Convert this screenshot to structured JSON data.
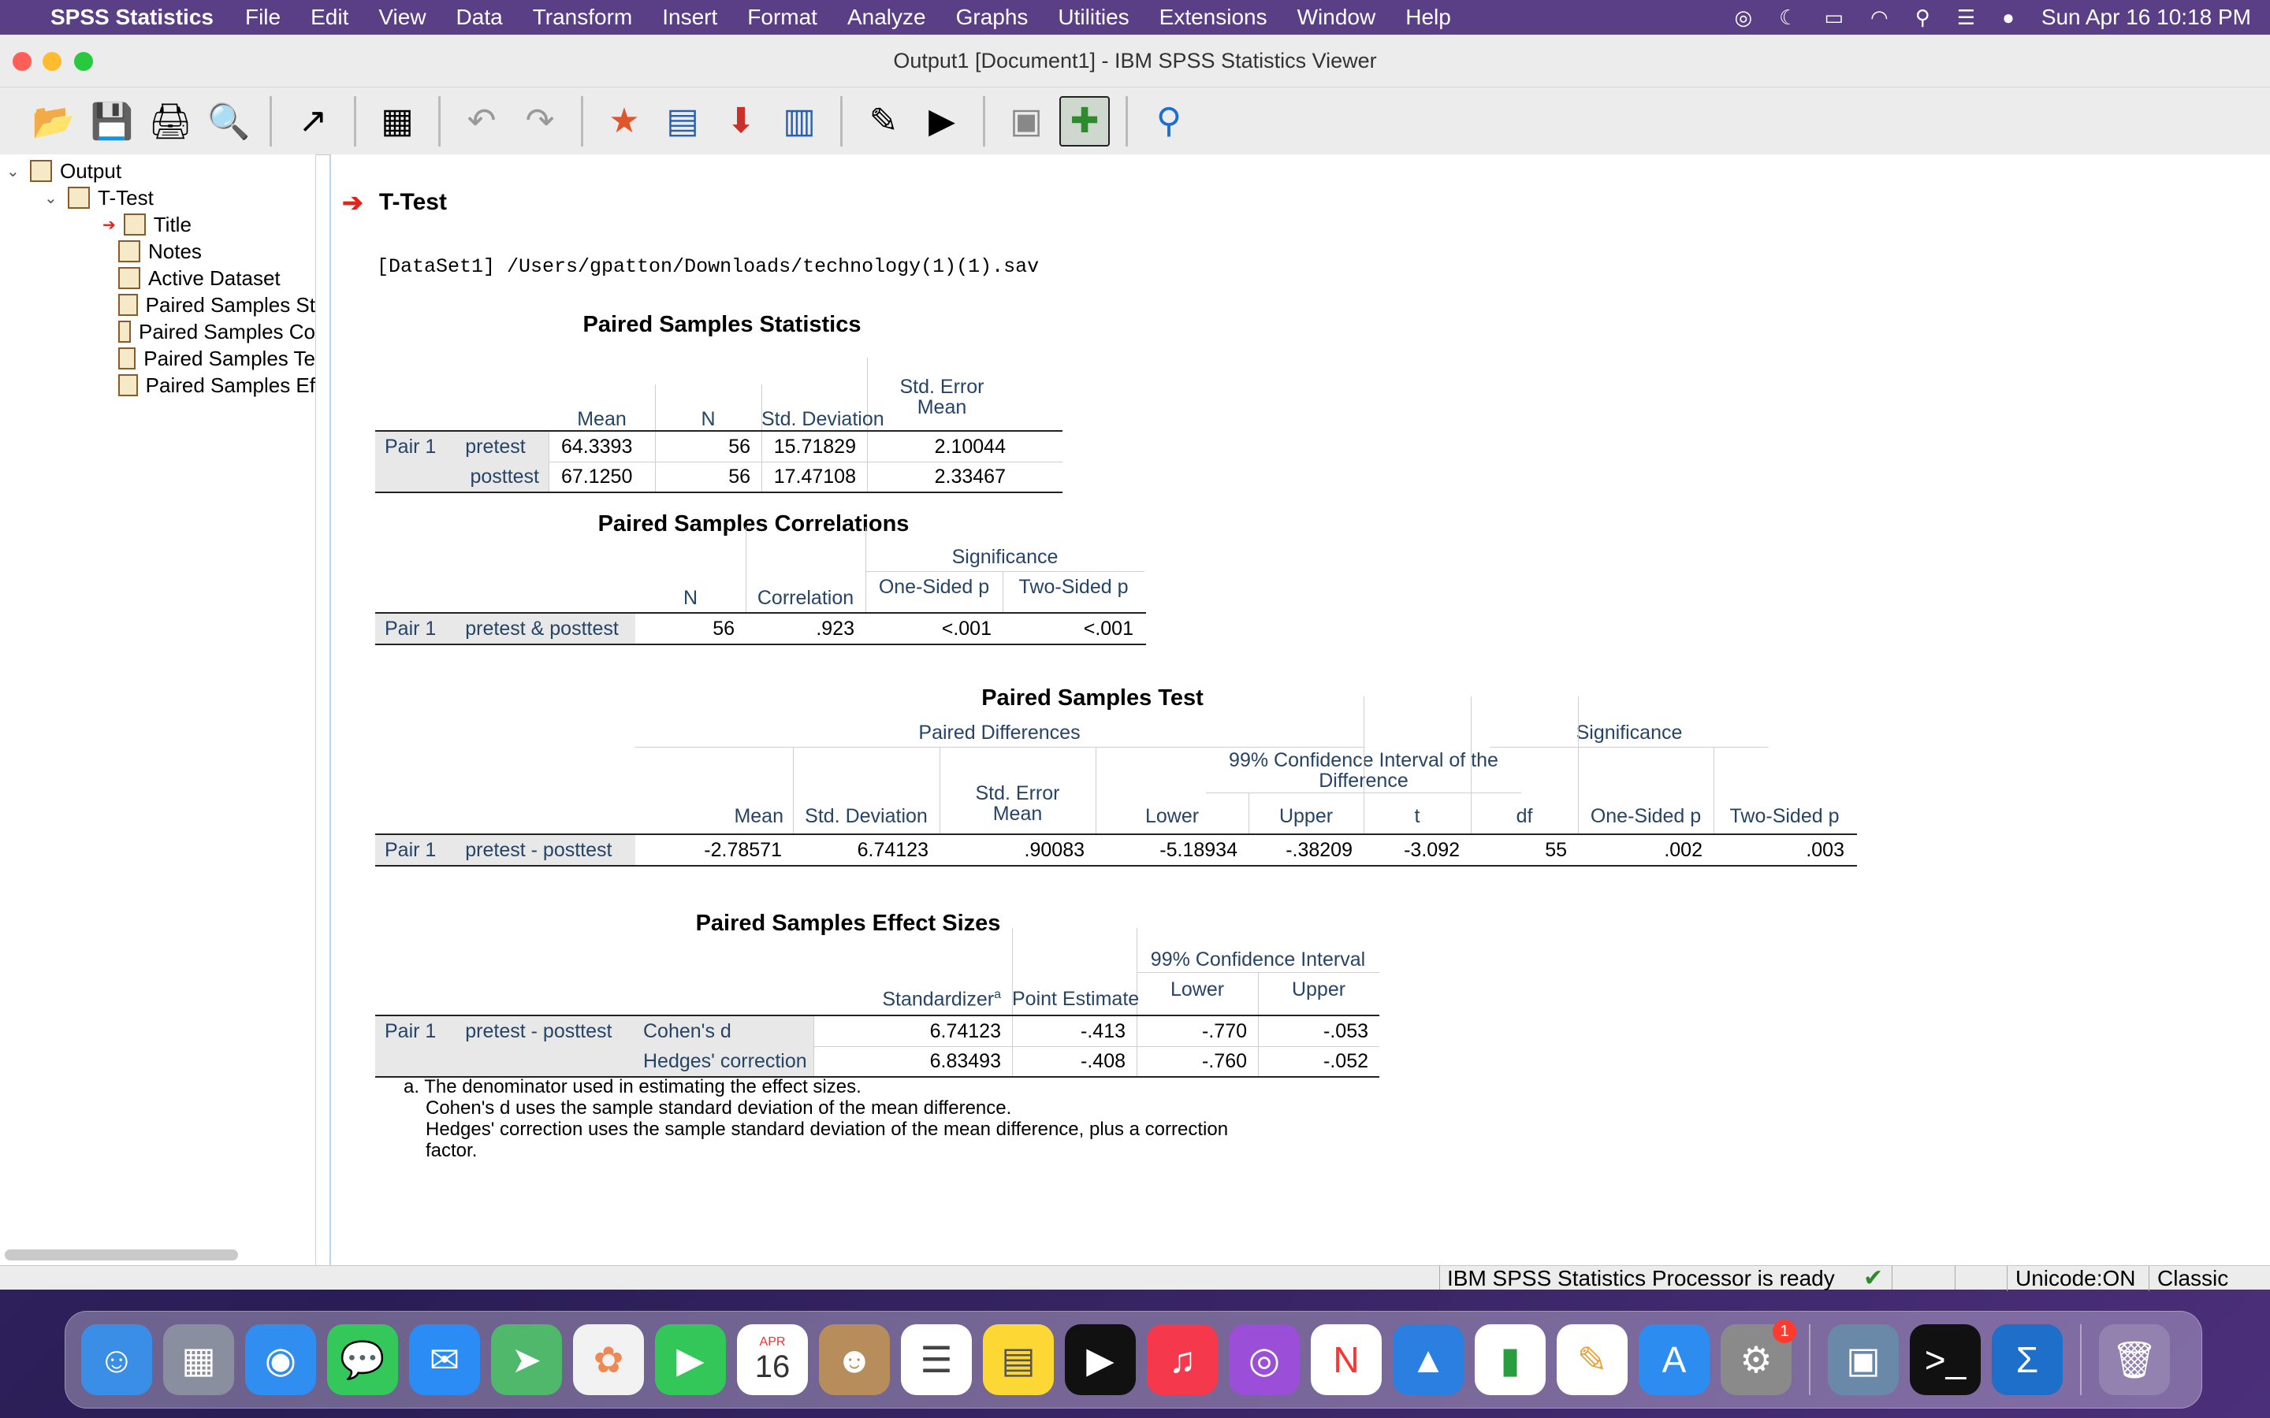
{
  "menubar": {
    "app_name": "SPSS Statistics",
    "items": [
      "File",
      "Edit",
      "View",
      "Data",
      "Transform",
      "Insert",
      "Format",
      "Analyze",
      "Graphs",
      "Utilities",
      "Extensions",
      "Window",
      "Help"
    ],
    "clock": "Sun Apr 16  10:18 PM"
  },
  "window": {
    "title": "Output1 [Document1] - IBM SPSS Statistics Viewer"
  },
  "toolbar": {
    "buttons": [
      "open-icon",
      "save-icon",
      "print-icon",
      "print-preview-icon",
      "export-icon",
      "recall-dialog-icon",
      "undo-icon",
      "redo-icon",
      "goto-case-icon",
      "goto-variable-icon",
      "variables-icon",
      "select-cases-icon",
      "value-labels-icon",
      "insert-output-icon",
      "insert-text-icon",
      "show-hide-icon",
      "designate-window-icon",
      "search-icon"
    ]
  },
  "outline": {
    "root": "Output",
    "group": "T-Test",
    "items": [
      "Title",
      "Notes",
      "Active Dataset",
      "Paired Samples St",
      "Paired Samples Co",
      "Paired Samples Te",
      "Paired Samples Ef"
    ]
  },
  "content": {
    "section_title": "T-Test",
    "dataset_line": "[DataSet1] /Users/gpatton/Downloads/technology(1)(1).sav"
  },
  "stats_table": {
    "title": "Paired Samples Statistics",
    "headers": [
      "Mean",
      "N",
      "Std. Deviation",
      "Std. Error Mean"
    ],
    "pair": "Pair 1",
    "rows": [
      {
        "label": "pretest",
        "values": [
          "64.3393",
          "56",
          "15.71829",
          "2.10044"
        ]
      },
      {
        "label": "posttest",
        "values": [
          "67.1250",
          "56",
          "17.47108",
          "2.33467"
        ]
      }
    ]
  },
  "corr_table": {
    "title": "Paired Samples Correlations",
    "significance": "Significance",
    "headers": [
      "N",
      "Correlation",
      "One-Sided p",
      "Two-Sided p"
    ],
    "pair": "Pair 1",
    "row_label": "pretest & posttest",
    "values": [
      "56",
      ".923",
      "<.001",
      "<.001"
    ]
  },
  "test_table": {
    "title": "Paired Samples Test",
    "paired_diff": "Paired Differences",
    "ci_header": "99% Confidence Interval of the Difference",
    "significance": "Significance",
    "headers": [
      "Mean",
      "Std. Deviation",
      "Std. Error Mean",
      "Lower",
      "Upper",
      "t",
      "df",
      "One-Sided p",
      "Two-Sided p"
    ],
    "pair": "Pair 1",
    "row_label": "pretest - posttest",
    "values": [
      "-2.78571",
      "6.74123",
      ".90083",
      "-5.18934",
      "-.38209",
      "-3.092",
      "55",
      ".002",
      ".003"
    ]
  },
  "effect_table": {
    "title": "Paired Samples Effect Sizes",
    "ci_header": "99% Confidence Interval",
    "headers": [
      "Standardizer",
      "Point Estimate",
      "Lower",
      "Upper"
    ],
    "superscript": "a",
    "pair": "Pair 1",
    "row_label": "pretest - posttest",
    "rows": [
      {
        "label": "Cohen's d",
        "values": [
          "6.74123",
          "-.413",
          "-.770",
          "-.053"
        ]
      },
      {
        "label": "Hedges' correction",
        "values": [
          "6.83493",
          "-.408",
          "-.760",
          "-.052"
        ]
      }
    ],
    "footnote": [
      "a. The denominator used in estimating the effect sizes.",
      "Cohen's d uses the sample standard deviation of the mean difference.",
      "Hedges' correction uses the sample standard deviation of the mean difference, plus a correction",
      "factor."
    ]
  },
  "statusbar": {
    "status": "IBM SPSS Statistics Processor is ready",
    "unicode": "Unicode:ON",
    "mode": "Classic"
  },
  "dock": {
    "calendar_month": "APR",
    "calendar_day": "16",
    "badge": "1"
  }
}
